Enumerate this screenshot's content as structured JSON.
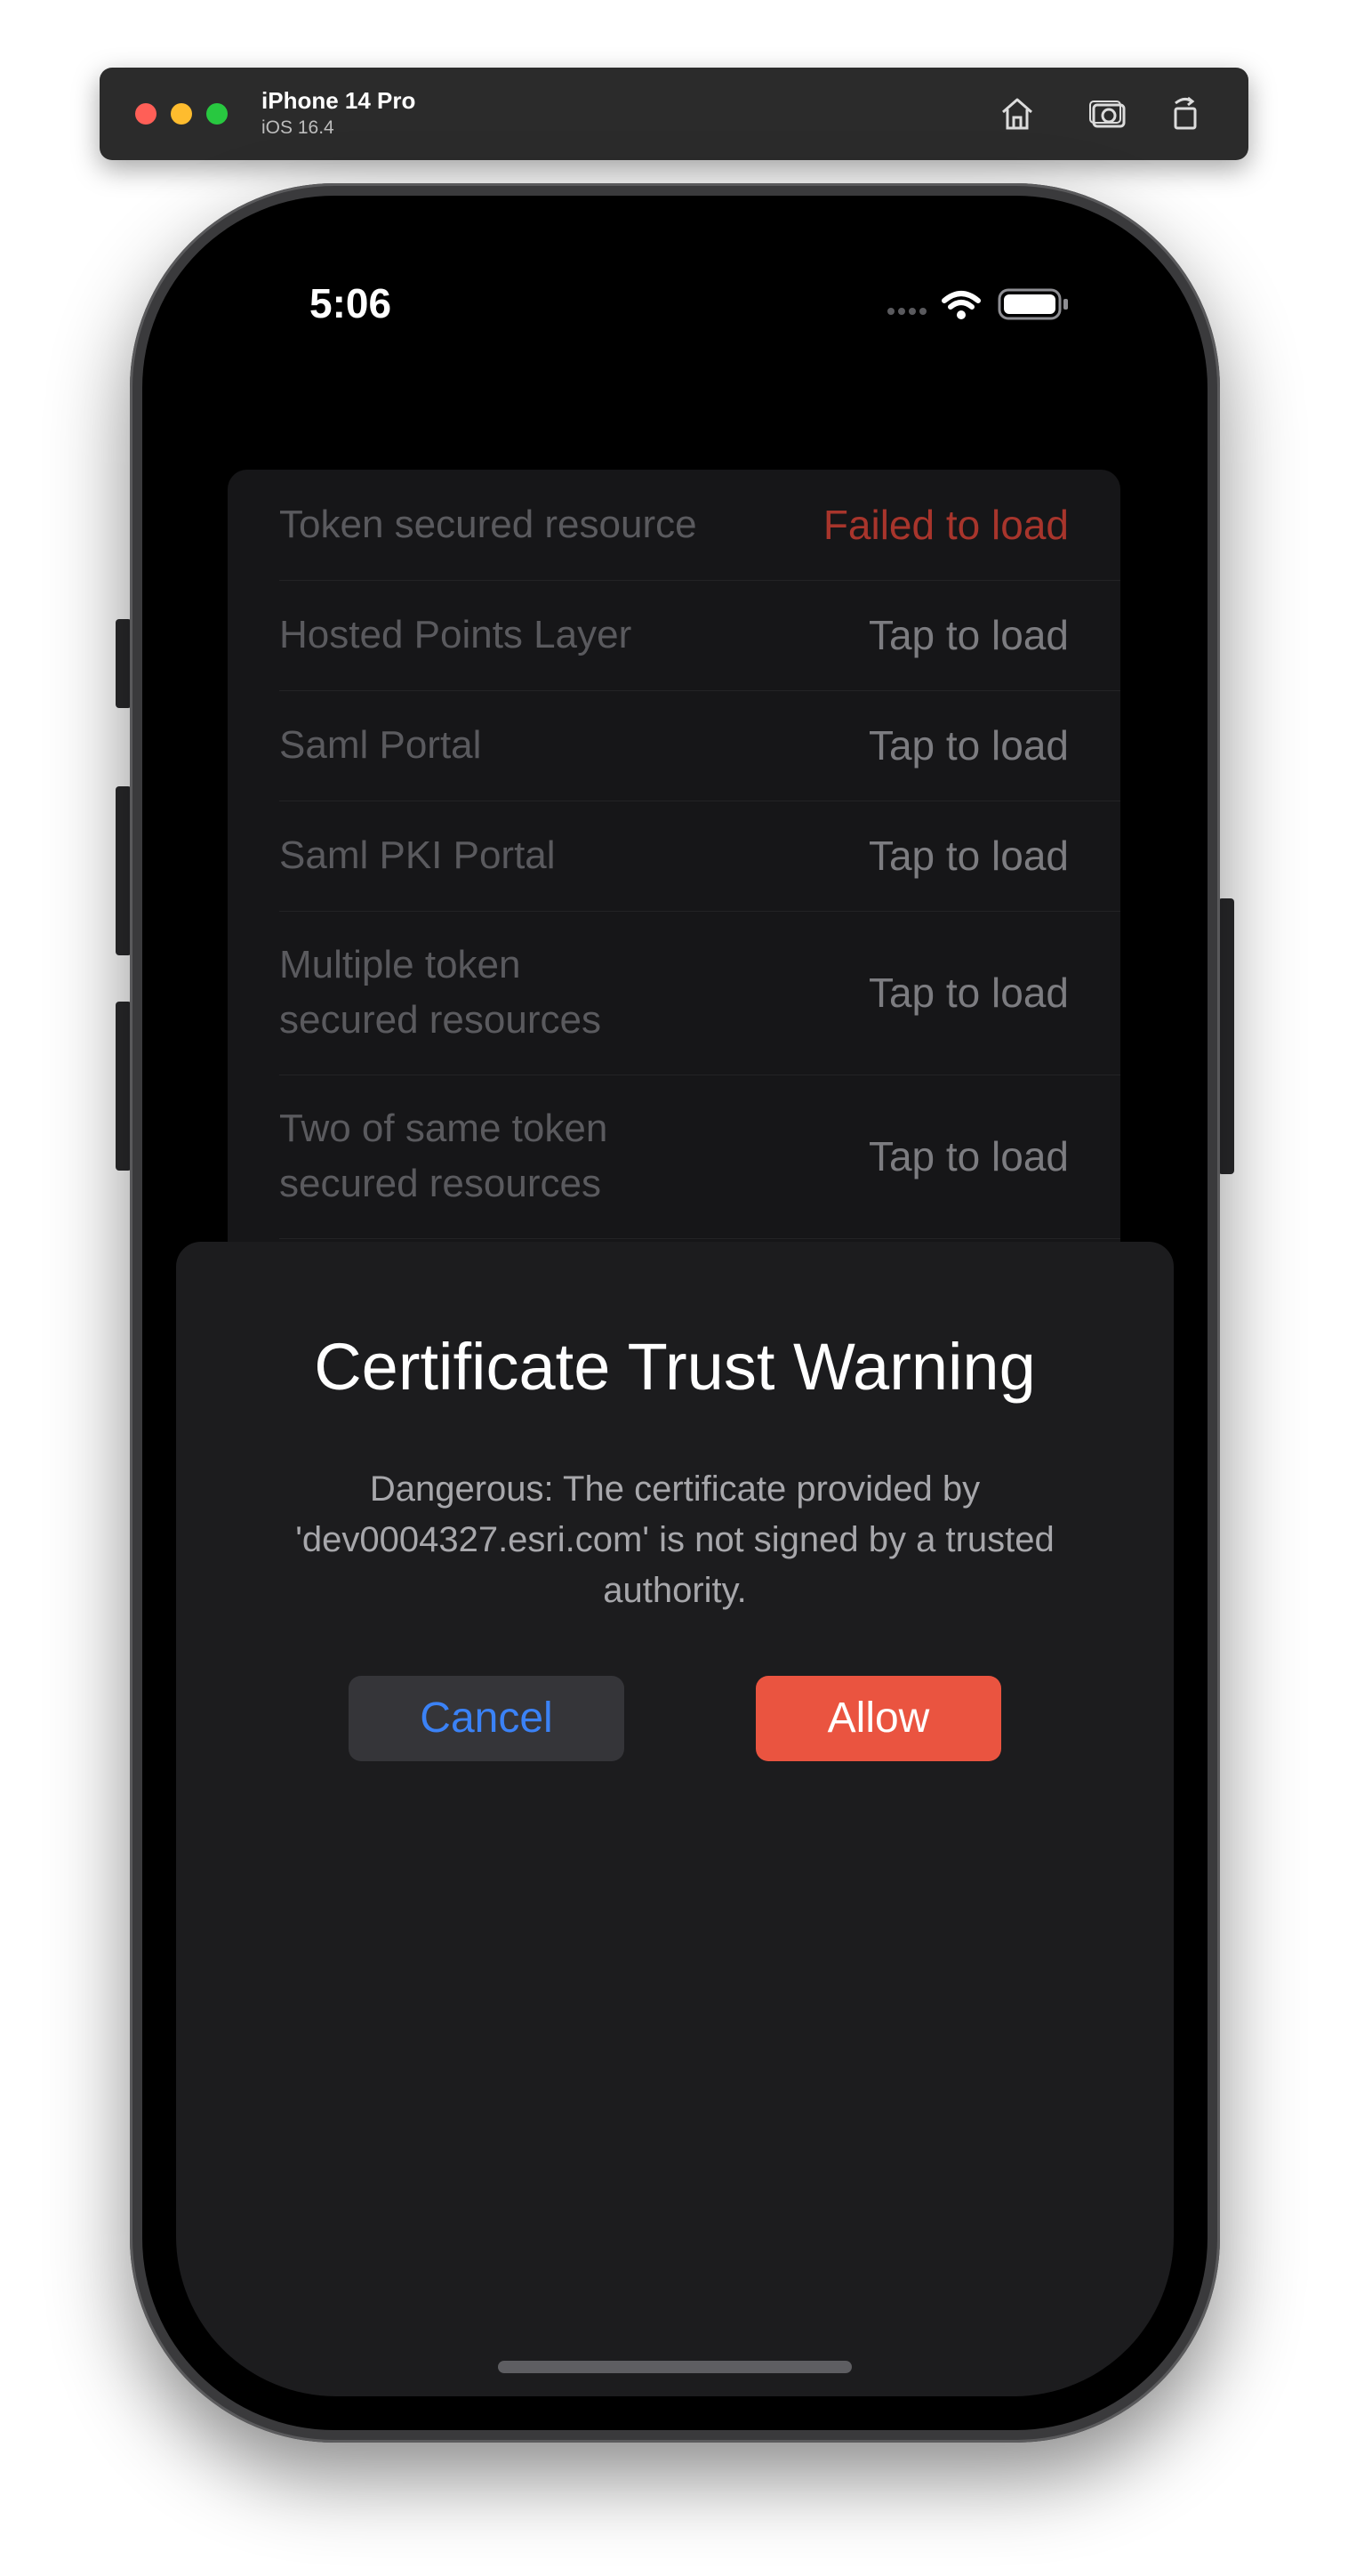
{
  "toolbar": {
    "device_name": "iPhone 14 Pro",
    "os_version": "iOS 16.4",
    "home_icon": "home-icon",
    "screenshot_icon": "camera-icon",
    "rotate_icon": "rotate-icon"
  },
  "status_bar": {
    "time": "5:06"
  },
  "list": {
    "rows": [
      {
        "title": "Token secured resource",
        "status": "Failed to load"
      },
      {
        "title": "Hosted Points Layer",
        "status": "Tap to load"
      },
      {
        "title": "Saml Portal",
        "status": "Tap to load"
      },
      {
        "title": "Saml PKI Portal",
        "status": "Tap to load"
      },
      {
        "title_line1": "Multiple token",
        "title_line2": "secured resources",
        "status": "Tap to load"
      },
      {
        "title_line1": "Two of same token",
        "title_line2": "secured resources",
        "status": "Tap to load"
      }
    ]
  },
  "sheet": {
    "title": "Certificate Trust Warning",
    "message": "Dangerous: The certificate provided by 'dev0004327.esri.com' is not signed by a trusted authority.",
    "cancel_label": "Cancel",
    "allow_label": "Allow"
  },
  "colors": {
    "failed": "#a8352c",
    "accent_blue": "#3b82f6",
    "allow_red": "#ea5440"
  }
}
